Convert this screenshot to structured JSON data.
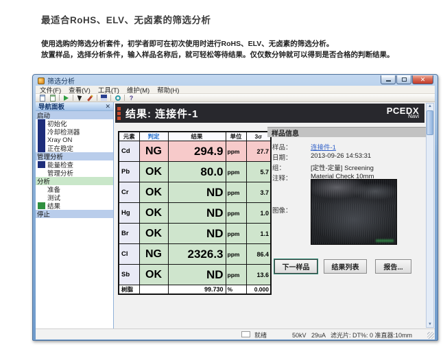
{
  "page": {
    "heading": "最适合RoHS、ELV、无卤素的筛选分析",
    "intro_line1": "使用选购的筛选分析套件，初学者即可在初次使用时进行RoHS、ELV、无卤素的筛选分析。",
    "intro_line2": "放置样品，选择分析条件，输入样品名称后，就可轻松等待结果。仅仅数分钟就可以得到是否合格的判断结果。"
  },
  "window": {
    "title": "筛选分析",
    "menu": [
      "文件(F)",
      "查看(V)",
      "工具(T)",
      "维护(M)",
      "帮助(H)"
    ],
    "toolbar_icons": [
      "new-document-icon",
      "open-document-icon",
      "start-measure-icon",
      "pointer-icon",
      "edit-icon",
      "save-icon",
      "mode-ring-icon",
      "help-icon"
    ]
  },
  "sidebar": {
    "title": "导航面板",
    "groups": [
      {
        "label": "启动",
        "items": [
          {
            "label": "初始化"
          },
          {
            "label": "冷却检测器"
          },
          {
            "label": "Xray ON"
          },
          {
            "label": "正在稳定"
          }
        ]
      },
      {
        "label": "管理分析",
        "items": [
          {
            "label": "能量检查"
          },
          {
            "label": "管理分析"
          }
        ]
      },
      {
        "label": "分析",
        "items": [
          {
            "label": "准备"
          },
          {
            "label": "测试"
          },
          {
            "label": "结果"
          }
        ]
      },
      {
        "label": "停止",
        "items": []
      }
    ]
  },
  "main": {
    "header_title": "结果: 连接件-1",
    "brand": "PCEDX",
    "brand_sub": "Navi",
    "table": {
      "headers": [
        "元素",
        "判定",
        "结果",
        "单位",
        "3σ"
      ],
      "rows": [
        {
          "element": "Cd",
          "judge": "NG",
          "result": "294.9",
          "unit": "ppm",
          "sigma": "27.7"
        },
        {
          "element": "Pb",
          "judge": "OK",
          "result": "80.0",
          "unit": "ppm",
          "sigma": "5.7"
        },
        {
          "element": "Cr",
          "judge": "OK",
          "result": "ND",
          "unit": "ppm",
          "sigma": "3.7"
        },
        {
          "element": "Hg",
          "judge": "OK",
          "result": "ND",
          "unit": "ppm",
          "sigma": "1.0"
        },
        {
          "element": "Br",
          "judge": "OK",
          "result": "ND",
          "unit": "ppm",
          "sigma": "1.1"
        },
        {
          "element": "Cl",
          "judge": "NG",
          "result": "2326.3",
          "unit": "ppm",
          "sigma": "86.4"
        },
        {
          "element": "Sb",
          "judge": "OK",
          "result": "ND",
          "unit": "ppm",
          "sigma": "13.6"
        }
      ],
      "footer": {
        "label": "树脂",
        "result": "99.730",
        "unit": "%",
        "sigma": "0.000"
      }
    },
    "sample_info": {
      "title": "样品信息",
      "fields": [
        {
          "label": "样品：",
          "value": "连接件-1"
        },
        {
          "label": "日期：",
          "value": "2013-09-26 14:53:31"
        },
        {
          "label": "组：",
          "value": "[定性-定量] Screening"
        },
        {
          "label": "注释：",
          "value": "Material Check 10mm"
        },
        {
          "label": "图像：",
          "value": ""
        }
      ]
    },
    "buttons": [
      "下一样品",
      "结果列表",
      "报告..."
    ]
  },
  "statusbar": {
    "ready": "就绪",
    "params": "50kV   29uA   滤光片: DT%: 0 准直器:10mm"
  },
  "colors": {
    "ng_row": "#f7caca",
    "ok_row": "#cfe5cd",
    "element_cell": "#e9eaf6",
    "judge_header_text": "#1565c8",
    "link": "#3060c8",
    "navy_marker": "#1d2d7a",
    "green_marker": "#2f8f3f",
    "result_header_bg": "#28282d",
    "red_square": "#c74a2e"
  }
}
